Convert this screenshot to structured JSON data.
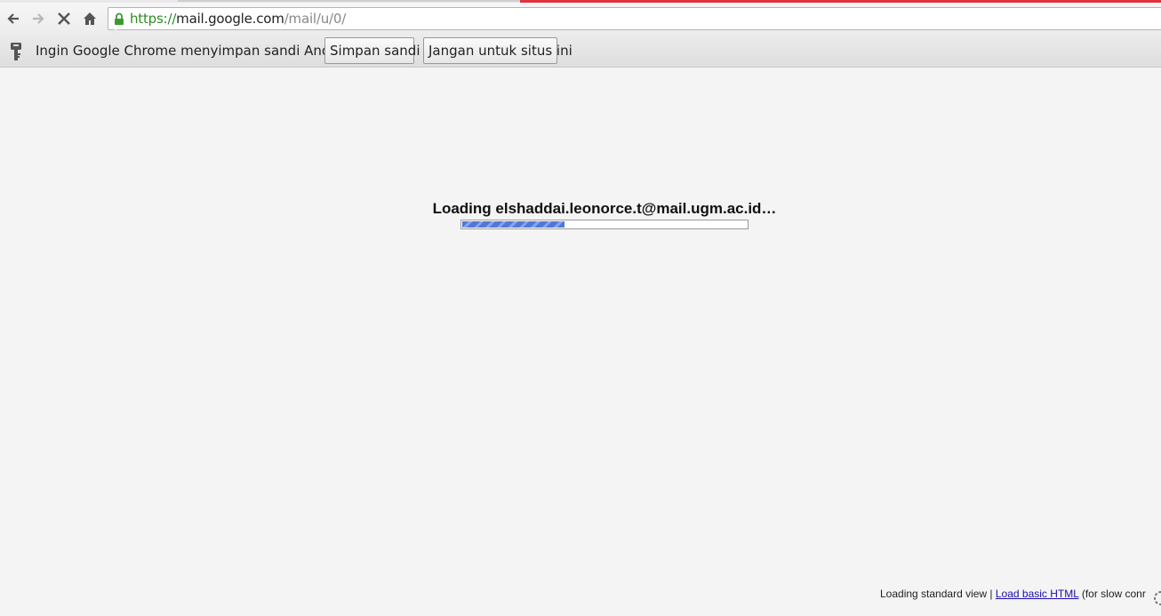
{
  "browser": {
    "url_scheme": "https://",
    "url_host": "mail.google.com",
    "url_path": "/mail/u/0/",
    "icons": {
      "back": "back-arrow-icon",
      "forward": "forward-arrow-icon",
      "stop": "stop-x-icon",
      "home": "home-icon",
      "secure": "lock-icon"
    }
  },
  "infobar": {
    "message": "Ingin Google Chrome menyimpan sandi Anda?",
    "save_label": "Simpan sandi",
    "never_label": "Jangan untuk situs ini",
    "icon": "key-icon"
  },
  "loading": {
    "text": "Loading elshaddai.leonorce.t@mail.ugm.ac.id…",
    "progress": 0.36
  },
  "footer": {
    "prefix": "Loading standard view | ",
    "link": "Load basic HTML",
    "suffix": " (for slow conr"
  },
  "colors": {
    "accent_red": "#e0323d",
    "secure_green": "#2e8b24",
    "progress_blue": "#5078d8",
    "link_blue": "#1a0dab"
  }
}
